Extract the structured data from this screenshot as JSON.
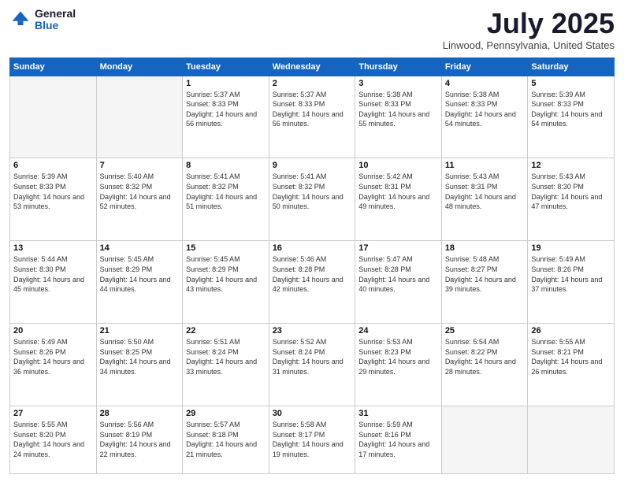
{
  "header": {
    "logo_general": "General",
    "logo_blue": "Blue",
    "month_title": "July 2025",
    "location": "Linwood, Pennsylvania, United States"
  },
  "days_of_week": [
    "Sunday",
    "Monday",
    "Tuesday",
    "Wednesday",
    "Thursday",
    "Friday",
    "Saturday"
  ],
  "weeks": [
    [
      {
        "day": "",
        "sunrise": "",
        "sunset": "",
        "daylight": ""
      },
      {
        "day": "",
        "sunrise": "",
        "sunset": "",
        "daylight": ""
      },
      {
        "day": "1",
        "sunrise": "Sunrise: 5:37 AM",
        "sunset": "Sunset: 8:33 PM",
        "daylight": "Daylight: 14 hours and 56 minutes."
      },
      {
        "day": "2",
        "sunrise": "Sunrise: 5:37 AM",
        "sunset": "Sunset: 8:33 PM",
        "daylight": "Daylight: 14 hours and 56 minutes."
      },
      {
        "day": "3",
        "sunrise": "Sunrise: 5:38 AM",
        "sunset": "Sunset: 8:33 PM",
        "daylight": "Daylight: 14 hours and 55 minutes."
      },
      {
        "day": "4",
        "sunrise": "Sunrise: 5:38 AM",
        "sunset": "Sunset: 8:33 PM",
        "daylight": "Daylight: 14 hours and 54 minutes."
      },
      {
        "day": "5",
        "sunrise": "Sunrise: 5:39 AM",
        "sunset": "Sunset: 8:33 PM",
        "daylight": "Daylight: 14 hours and 54 minutes."
      }
    ],
    [
      {
        "day": "6",
        "sunrise": "Sunrise: 5:39 AM",
        "sunset": "Sunset: 8:33 PM",
        "daylight": "Daylight: 14 hours and 53 minutes."
      },
      {
        "day": "7",
        "sunrise": "Sunrise: 5:40 AM",
        "sunset": "Sunset: 8:32 PM",
        "daylight": "Daylight: 14 hours and 52 minutes."
      },
      {
        "day": "8",
        "sunrise": "Sunrise: 5:41 AM",
        "sunset": "Sunset: 8:32 PM",
        "daylight": "Daylight: 14 hours and 51 minutes."
      },
      {
        "day": "9",
        "sunrise": "Sunrise: 5:41 AM",
        "sunset": "Sunset: 8:32 PM",
        "daylight": "Daylight: 14 hours and 50 minutes."
      },
      {
        "day": "10",
        "sunrise": "Sunrise: 5:42 AM",
        "sunset": "Sunset: 8:31 PM",
        "daylight": "Daylight: 14 hours and 49 minutes."
      },
      {
        "day": "11",
        "sunrise": "Sunrise: 5:43 AM",
        "sunset": "Sunset: 8:31 PM",
        "daylight": "Daylight: 14 hours and 48 minutes."
      },
      {
        "day": "12",
        "sunrise": "Sunrise: 5:43 AM",
        "sunset": "Sunset: 8:30 PM",
        "daylight": "Daylight: 14 hours and 47 minutes."
      }
    ],
    [
      {
        "day": "13",
        "sunrise": "Sunrise: 5:44 AM",
        "sunset": "Sunset: 8:30 PM",
        "daylight": "Daylight: 14 hours and 45 minutes."
      },
      {
        "day": "14",
        "sunrise": "Sunrise: 5:45 AM",
        "sunset": "Sunset: 8:29 PM",
        "daylight": "Daylight: 14 hours and 44 minutes."
      },
      {
        "day": "15",
        "sunrise": "Sunrise: 5:45 AM",
        "sunset": "Sunset: 8:29 PM",
        "daylight": "Daylight: 14 hours and 43 minutes."
      },
      {
        "day": "16",
        "sunrise": "Sunrise: 5:46 AM",
        "sunset": "Sunset: 8:28 PM",
        "daylight": "Daylight: 14 hours and 42 minutes."
      },
      {
        "day": "17",
        "sunrise": "Sunrise: 5:47 AM",
        "sunset": "Sunset: 8:28 PM",
        "daylight": "Daylight: 14 hours and 40 minutes."
      },
      {
        "day": "18",
        "sunrise": "Sunrise: 5:48 AM",
        "sunset": "Sunset: 8:27 PM",
        "daylight": "Daylight: 14 hours and 39 minutes."
      },
      {
        "day": "19",
        "sunrise": "Sunrise: 5:49 AM",
        "sunset": "Sunset: 8:26 PM",
        "daylight": "Daylight: 14 hours and 37 minutes."
      }
    ],
    [
      {
        "day": "20",
        "sunrise": "Sunrise: 5:49 AM",
        "sunset": "Sunset: 8:26 PM",
        "daylight": "Daylight: 14 hours and 36 minutes."
      },
      {
        "day": "21",
        "sunrise": "Sunrise: 5:50 AM",
        "sunset": "Sunset: 8:25 PM",
        "daylight": "Daylight: 14 hours and 34 minutes."
      },
      {
        "day": "22",
        "sunrise": "Sunrise: 5:51 AM",
        "sunset": "Sunset: 8:24 PM",
        "daylight": "Daylight: 14 hours and 33 minutes."
      },
      {
        "day": "23",
        "sunrise": "Sunrise: 5:52 AM",
        "sunset": "Sunset: 8:24 PM",
        "daylight": "Daylight: 14 hours and 31 minutes."
      },
      {
        "day": "24",
        "sunrise": "Sunrise: 5:53 AM",
        "sunset": "Sunset: 8:23 PM",
        "daylight": "Daylight: 14 hours and 29 minutes."
      },
      {
        "day": "25",
        "sunrise": "Sunrise: 5:54 AM",
        "sunset": "Sunset: 8:22 PM",
        "daylight": "Daylight: 14 hours and 28 minutes."
      },
      {
        "day": "26",
        "sunrise": "Sunrise: 5:55 AM",
        "sunset": "Sunset: 8:21 PM",
        "daylight": "Daylight: 14 hours and 26 minutes."
      }
    ],
    [
      {
        "day": "27",
        "sunrise": "Sunrise: 5:55 AM",
        "sunset": "Sunset: 8:20 PM",
        "daylight": "Daylight: 14 hours and 24 minutes."
      },
      {
        "day": "28",
        "sunrise": "Sunrise: 5:56 AM",
        "sunset": "Sunset: 8:19 PM",
        "daylight": "Daylight: 14 hours and 22 minutes."
      },
      {
        "day": "29",
        "sunrise": "Sunrise: 5:57 AM",
        "sunset": "Sunset: 8:18 PM",
        "daylight": "Daylight: 14 hours and 21 minutes."
      },
      {
        "day": "30",
        "sunrise": "Sunrise: 5:58 AM",
        "sunset": "Sunset: 8:17 PM",
        "daylight": "Daylight: 14 hours and 19 minutes."
      },
      {
        "day": "31",
        "sunrise": "Sunrise: 5:59 AM",
        "sunset": "Sunset: 8:16 PM",
        "daylight": "Daylight: 14 hours and 17 minutes."
      },
      {
        "day": "",
        "sunrise": "",
        "sunset": "",
        "daylight": ""
      },
      {
        "day": "",
        "sunrise": "",
        "sunset": "",
        "daylight": ""
      }
    ]
  ]
}
